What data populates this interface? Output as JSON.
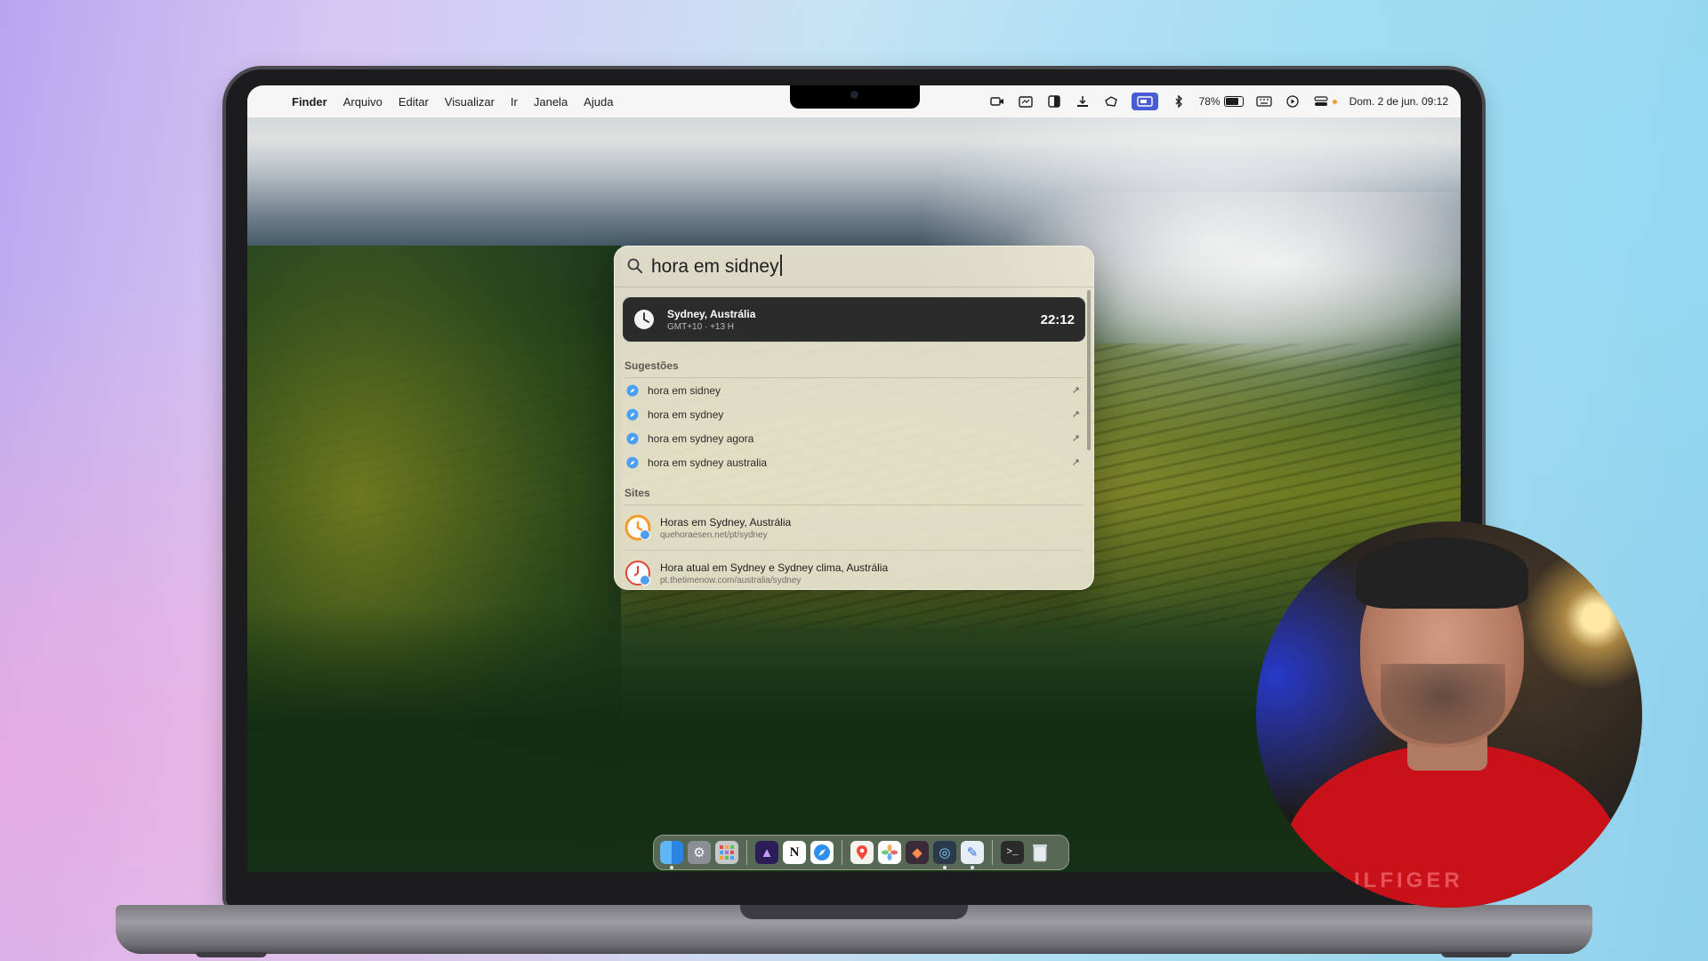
{
  "menubar": {
    "app_name": "Finder",
    "menus": [
      "Arquivo",
      "Editar",
      "Visualizar",
      "Ir",
      "Janela",
      "Ajuda"
    ],
    "battery_percent": "78%",
    "clock": "Dom. 2 de jun. 09:12"
  },
  "spotlight": {
    "query": "hora em sidney",
    "top_hit": {
      "title": "Sydney, Austrália",
      "subtitle": "GMT+10 · +13 H",
      "time": "22:12"
    },
    "suggestions_title": "Sugestões",
    "suggestions": [
      "hora em sidney",
      "hora em sydney",
      "hora em sydney agora",
      "hora em sydney australia"
    ],
    "sites_title": "Sites",
    "sites": [
      {
        "title": "Horas em Sydney, Austrália",
        "url": "quehoraesen.net/pt/sydney"
      },
      {
        "title": "Hora atual em Sydney e Sydney clima, Austrália",
        "url": "pt.thetimenow.com/australia/sydney"
      }
    ]
  },
  "dock": {
    "icons": [
      "finder-icon",
      "system-settings-icon",
      "launchpad-icon",
      "affinity-icon",
      "notion-icon",
      "safari-icon",
      "maps-icon",
      "photos-icon",
      "affinity-photo-icon",
      "quicktime-icon",
      "xcode-icon",
      "terminal-icon",
      "trash-icon"
    ]
  },
  "webcam": {
    "shirt_text": "ILFIGER"
  },
  "colors": {
    "accent": "#4a5bd6",
    "tophit_bg": "#2b2b2b",
    "shirt": "#c9111a"
  }
}
